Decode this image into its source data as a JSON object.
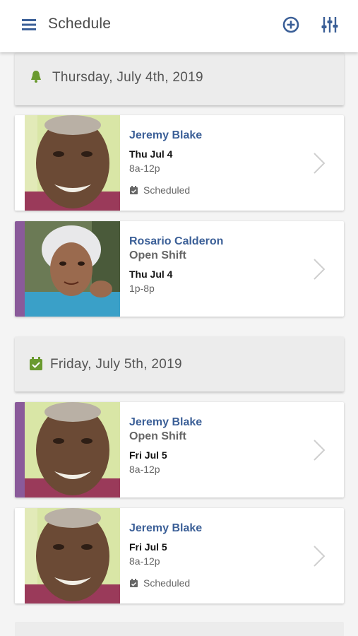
{
  "app": {
    "title": "Schedule",
    "accent": "#3b5f97",
    "icons": {
      "menu": "hamburger-menu-icon",
      "add": "add-circle-icon",
      "filter": "filter-sliders-icon"
    }
  },
  "days": [
    {
      "label": "Thursday, July 4th, 2019",
      "icon": "holiday-bell-icon",
      "icon_color": "#6a9a2f",
      "shifts": [
        {
          "name": "Jeremy Blake",
          "open_shift": "",
          "date": "Thu Jul 4",
          "time": "8a-12p",
          "status": "Scheduled",
          "stripe_color": "#ffffff"
        },
        {
          "name": "Rosario Calderon",
          "open_shift": "Open Shift",
          "date": "Thu Jul 4",
          "time": "1p-8p",
          "status": "",
          "stripe_color": "#8a5a9a"
        }
      ]
    },
    {
      "label": "Friday, July 5th, 2019",
      "icon": "calendar-check-icon",
      "icon_color": "#6a9a2f",
      "shifts": [
        {
          "name": "Jeremy Blake",
          "open_shift": "Open Shift",
          "date": "Fri Jul 5",
          "time": "8a-12p",
          "status": "",
          "stripe_color": "#8a5a9a"
        },
        {
          "name": "Jeremy Blake",
          "open_shift": "",
          "date": "Fri Jul 5",
          "time": "8a-12p",
          "status": "Scheduled",
          "stripe_color": "#ffffff"
        }
      ]
    }
  ]
}
